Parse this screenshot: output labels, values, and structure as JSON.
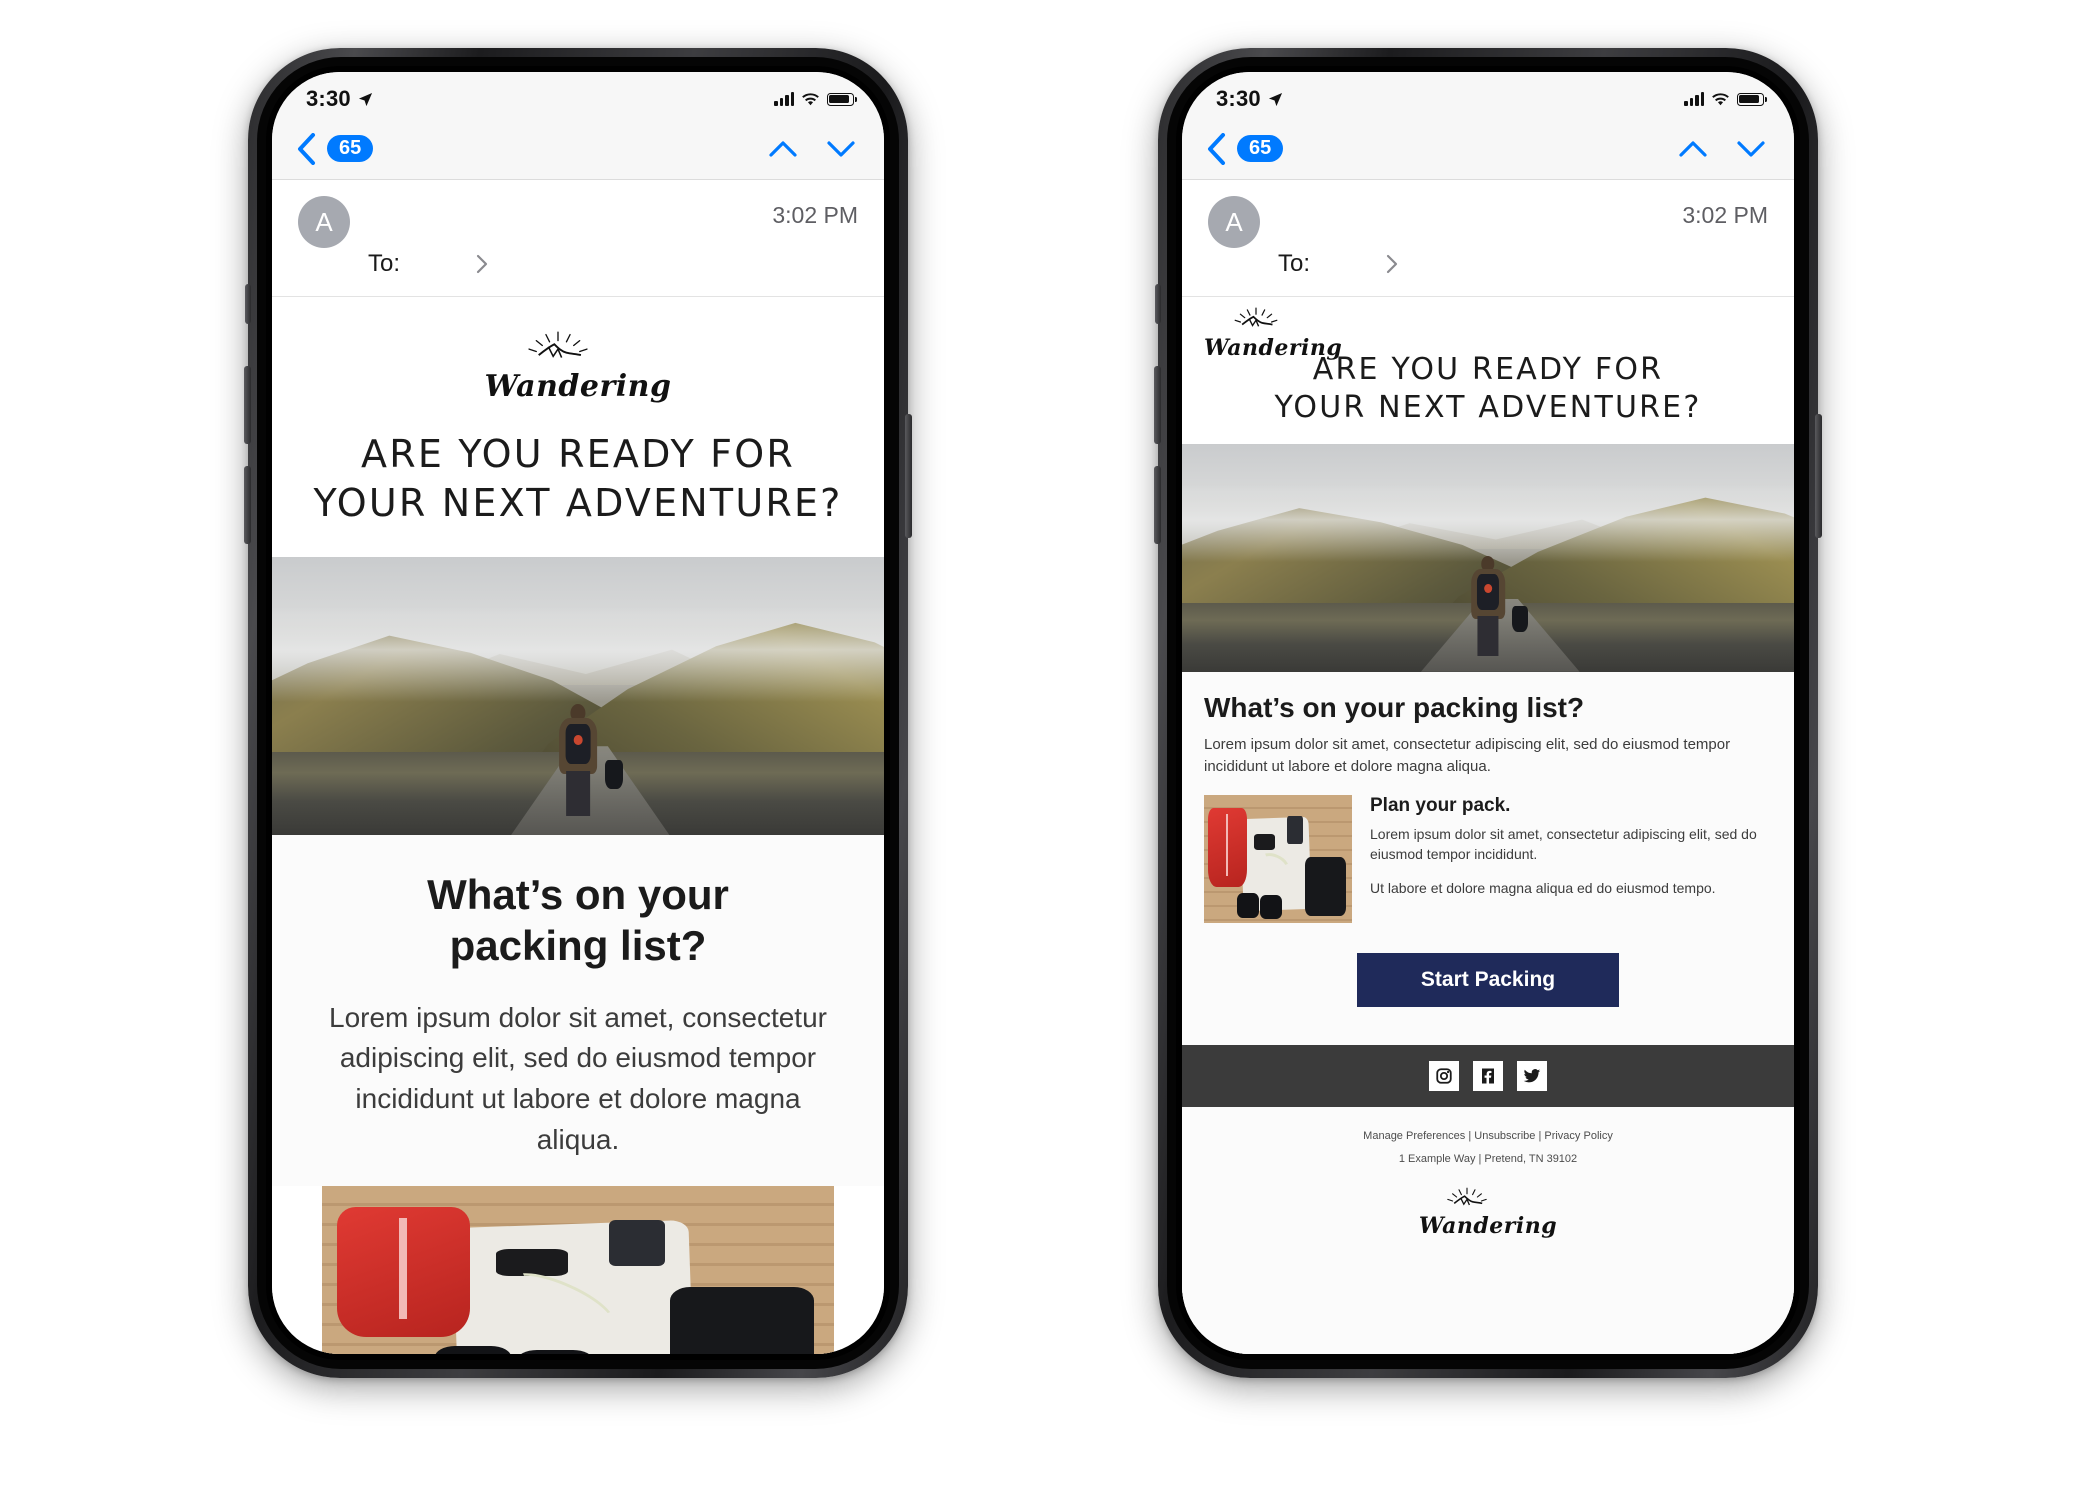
{
  "status_bar": {
    "time": "3:30",
    "location_icon": "location-arrow-icon",
    "signal_icon": "cellular-bars-icon",
    "wifi_icon": "wifi-icon",
    "battery_icon": "battery-icon"
  },
  "mail_nav": {
    "back_icon": "chevron-left-icon",
    "unread_badge": "65",
    "up_icon": "chevron-up-icon",
    "down_icon": "chevron-down-icon"
  },
  "mail_header": {
    "avatar_initial": "A",
    "timestamp": "3:02 PM",
    "to_label": "To:",
    "details_icon": "chevron-right-icon"
  },
  "email": {
    "brand_logo_text": "Wandering",
    "hero_headline_line1": "ARE YOU READY FOR",
    "hero_headline_line2": "YOUR NEXT ADVENTURE?",
    "hero_image_alt": "hiker-in-mountain-valley-photo",
    "article_heading": "What’s on your packing list?",
    "article_heading_line1": "What’s on your",
    "article_heading_line2": "packing list?",
    "article_body": "Lorem ipsum dolor sit amet, consectetur adipiscing elit, sed do eiusmod tempor incididunt ut labore et dolore magna aliqua.",
    "pack_image_alt": "flat-lay-packing-gear-photo",
    "pack_heading": "Plan your pack.",
    "pack_body_1": "Lorem ipsum dolor sit amet, consectetur adipiscing elit, sed do eiusmod tempor incididunt.",
    "pack_body_2": "Ut labore et dolore magna aliqua ed do eiusmod tempo.",
    "cta_label": "Start Packing",
    "cta_color": "#1f2a5a"
  },
  "social": {
    "bar_color": "#3b3b3b",
    "items": [
      {
        "name": "instagram-icon"
      },
      {
        "name": "facebook-icon"
      },
      {
        "name": "twitter-icon"
      }
    ]
  },
  "footer": {
    "links_line": "Manage Preferences | Unsubscribe | Privacy Policy",
    "address_line": "1 Example Way | Pretend, TN 39102",
    "logo_text": "Wandering"
  },
  "colors": {
    "ios_blue": "#007aff",
    "navy": "#1f2a5a",
    "dark_gray": "#3b3b3b"
  }
}
